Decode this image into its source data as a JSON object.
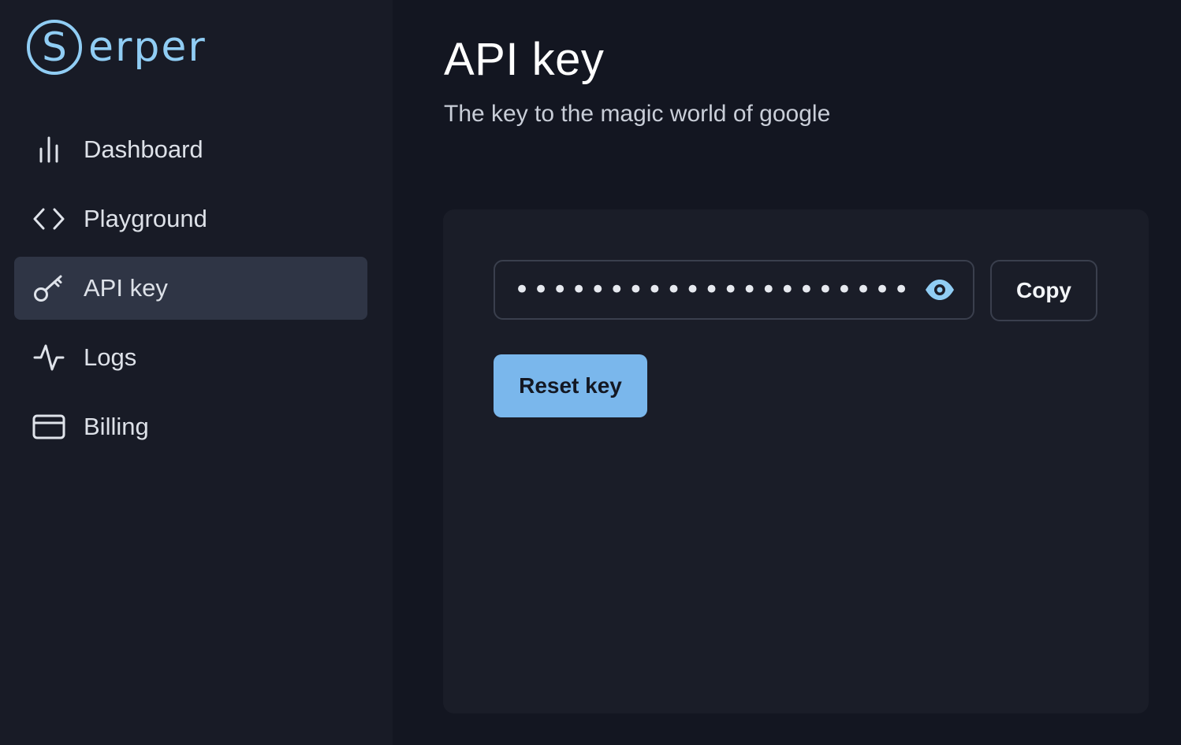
{
  "brand": {
    "logo_letter": "S",
    "logo_text": "erper",
    "accent_color": "#90cdf4"
  },
  "sidebar": {
    "items": [
      {
        "label": "Dashboard",
        "icon": "bar-chart-icon",
        "active": false
      },
      {
        "label": "Playground",
        "icon": "code-icon",
        "active": false
      },
      {
        "label": "API key",
        "icon": "key-icon",
        "active": true
      },
      {
        "label": "Logs",
        "icon": "activity-icon",
        "active": false
      },
      {
        "label": "Billing",
        "icon": "credit-card-icon",
        "active": false
      }
    ]
  },
  "main": {
    "title": "API key",
    "subtitle": "The key to the magic world of google",
    "api_key": {
      "masked_value": "•••••••••••••••••••••••••••••••••••",
      "visibility_icon": "eye-icon",
      "copy_label": "Copy"
    },
    "reset_label": "Reset key",
    "reset_color": "#7ab7ec"
  }
}
